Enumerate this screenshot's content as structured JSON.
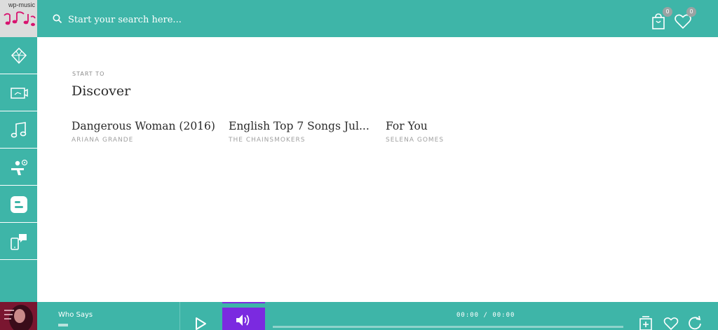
{
  "logo": {
    "text": "wp-music"
  },
  "search": {
    "placeholder": "Start your search here..."
  },
  "header": {
    "cart_count": "0",
    "wishlist_count": "0"
  },
  "sidebar": {
    "items": [
      {
        "icon": "diamond-icon"
      },
      {
        "icon": "video-icon"
      },
      {
        "icon": "music-note-icon"
      },
      {
        "icon": "dj-icon"
      },
      {
        "icon": "blogger-icon"
      },
      {
        "icon": "mobile-chat-icon"
      }
    ]
  },
  "main": {
    "kicker": "START TO",
    "title": "Discover",
    "albums": [
      {
        "title": "Dangerous Woman (2016)",
        "artist": "ARIANA GRANDE"
      },
      {
        "title": "English Top 7 Songs Jul...",
        "artist": "THE CHAINSMOKERS"
      },
      {
        "title": "For You",
        "artist": "SELENA GOMES"
      }
    ]
  },
  "player": {
    "track_title": "Who Says",
    "time": "00:00 / 00:00",
    "progress": 0
  },
  "colors": {
    "accent": "#3eb5a8",
    "volume": "#7b2ae0",
    "cover": "#7a1630"
  }
}
